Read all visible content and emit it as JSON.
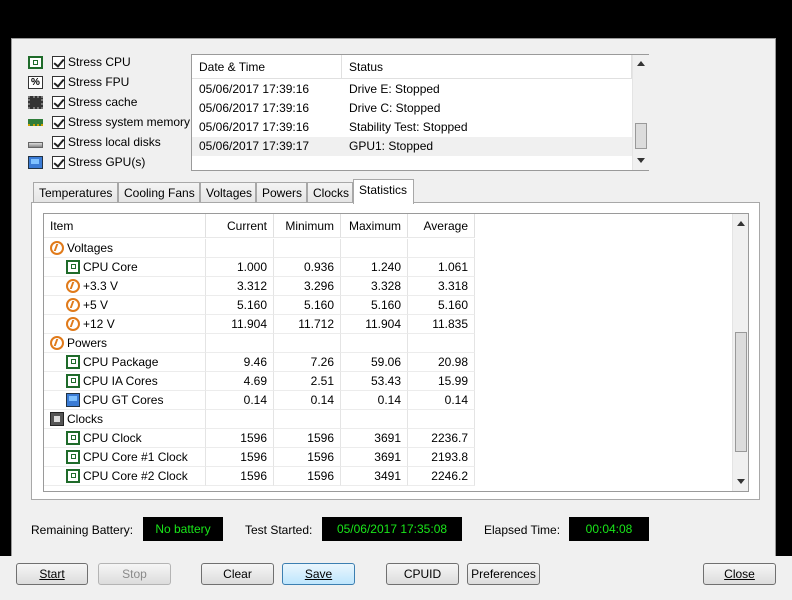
{
  "stress_options": [
    {
      "label": "Stress CPU",
      "icon": "cpu-chip-icon",
      "checked": true
    },
    {
      "label": "Stress FPU",
      "icon": "percent-icon",
      "checked": true
    },
    {
      "label": "Stress cache",
      "icon": "cache-chip-icon",
      "checked": true
    },
    {
      "label": "Stress system memory",
      "icon": "memory-module-icon",
      "checked": true
    },
    {
      "label": "Stress local disks",
      "icon": "disk-drive-icon",
      "checked": true
    },
    {
      "label": "Stress GPU(s)",
      "icon": "gpu-monitor-icon",
      "checked": true
    }
  ],
  "log": {
    "headers": {
      "datetime": "Date & Time",
      "status": "Status"
    },
    "rows": [
      {
        "datetime": "05/06/2017 17:39:16",
        "status": "Drive E: Stopped"
      },
      {
        "datetime": "05/06/2017 17:39:16",
        "status": "Drive C: Stopped"
      },
      {
        "datetime": "05/06/2017 17:39:16",
        "status": "Stability Test: Stopped"
      },
      {
        "datetime": "05/06/2017 17:39:17",
        "status": "GPU1: Stopped"
      }
    ]
  },
  "tabs": [
    "Temperatures",
    "Cooling Fans",
    "Voltages",
    "Powers",
    "Clocks",
    "Statistics"
  ],
  "active_tab": "Statistics",
  "stats": {
    "headers": {
      "item": "Item",
      "current": "Current",
      "minimum": "Minimum",
      "maximum": "Maximum",
      "average": "Average"
    },
    "rows": [
      {
        "group": true,
        "icon": "voltage-icon",
        "item": "Voltages",
        "current": "",
        "minimum": "",
        "maximum": "",
        "average": ""
      },
      {
        "group": false,
        "icon": "cpu-chip-icon",
        "item": "CPU Core",
        "current": "1.000",
        "minimum": "0.936",
        "maximum": "1.240",
        "average": "1.061"
      },
      {
        "group": false,
        "icon": "voltage-icon",
        "item": "+3.3 V",
        "current": "3.312",
        "minimum": "3.296",
        "maximum": "3.328",
        "average": "3.318"
      },
      {
        "group": false,
        "icon": "voltage-icon",
        "item": "+5 V",
        "current": "5.160",
        "minimum": "5.160",
        "maximum": "5.160",
        "average": "5.160"
      },
      {
        "group": false,
        "icon": "voltage-icon",
        "item": "+12 V",
        "current": "11.904",
        "minimum": "11.712",
        "maximum": "11.904",
        "average": "11.835"
      },
      {
        "group": true,
        "icon": "voltage-icon",
        "item": "Powers",
        "current": "",
        "minimum": "",
        "maximum": "",
        "average": ""
      },
      {
        "group": false,
        "icon": "cpu-chip-icon",
        "item": "CPU Package",
        "current": "9.46",
        "minimum": "7.26",
        "maximum": "59.06",
        "average": "20.98"
      },
      {
        "group": false,
        "icon": "cpu-chip-icon",
        "item": "CPU IA Cores",
        "current": "4.69",
        "minimum": "2.51",
        "maximum": "53.43",
        "average": "15.99"
      },
      {
        "group": false,
        "icon": "gpu-monitor-icon",
        "item": "CPU GT Cores",
        "current": "0.14",
        "minimum": "0.14",
        "maximum": "0.14",
        "average": "0.14"
      },
      {
        "group": true,
        "icon": "clock-icon",
        "item": "Clocks",
        "current": "",
        "minimum": "",
        "maximum": "",
        "average": ""
      },
      {
        "group": false,
        "icon": "cpu-chip-icon",
        "item": "CPU Clock",
        "current": "1596",
        "minimum": "1596",
        "maximum": "3691",
        "average": "2236.7"
      },
      {
        "group": false,
        "icon": "cpu-chip-icon",
        "item": "CPU Core #1 Clock",
        "current": "1596",
        "minimum": "1596",
        "maximum": "3691",
        "average": "2193.8"
      },
      {
        "group": false,
        "icon": "cpu-chip-icon",
        "item": "CPU Core #2 Clock",
        "current": "1596",
        "minimum": "1596",
        "maximum": "3491",
        "average": "2246.2"
      }
    ]
  },
  "status": {
    "battery_label": "Remaining Battery:",
    "battery_value": "No battery",
    "started_label": "Test Started:",
    "started_value": "05/06/2017 17:35:08",
    "elapsed_label": "Elapsed Time:",
    "elapsed_value": "00:04:08"
  },
  "buttons": {
    "start": "Start",
    "stop": "Stop",
    "clear": "Clear",
    "save": "Save",
    "cpuid": "CPUID",
    "preferences": "Preferences",
    "close": "Close"
  },
  "colors": {
    "status_value_text": "#19e619",
    "status_value_bg": "#000000",
    "primary_button": "#bee6fd"
  }
}
